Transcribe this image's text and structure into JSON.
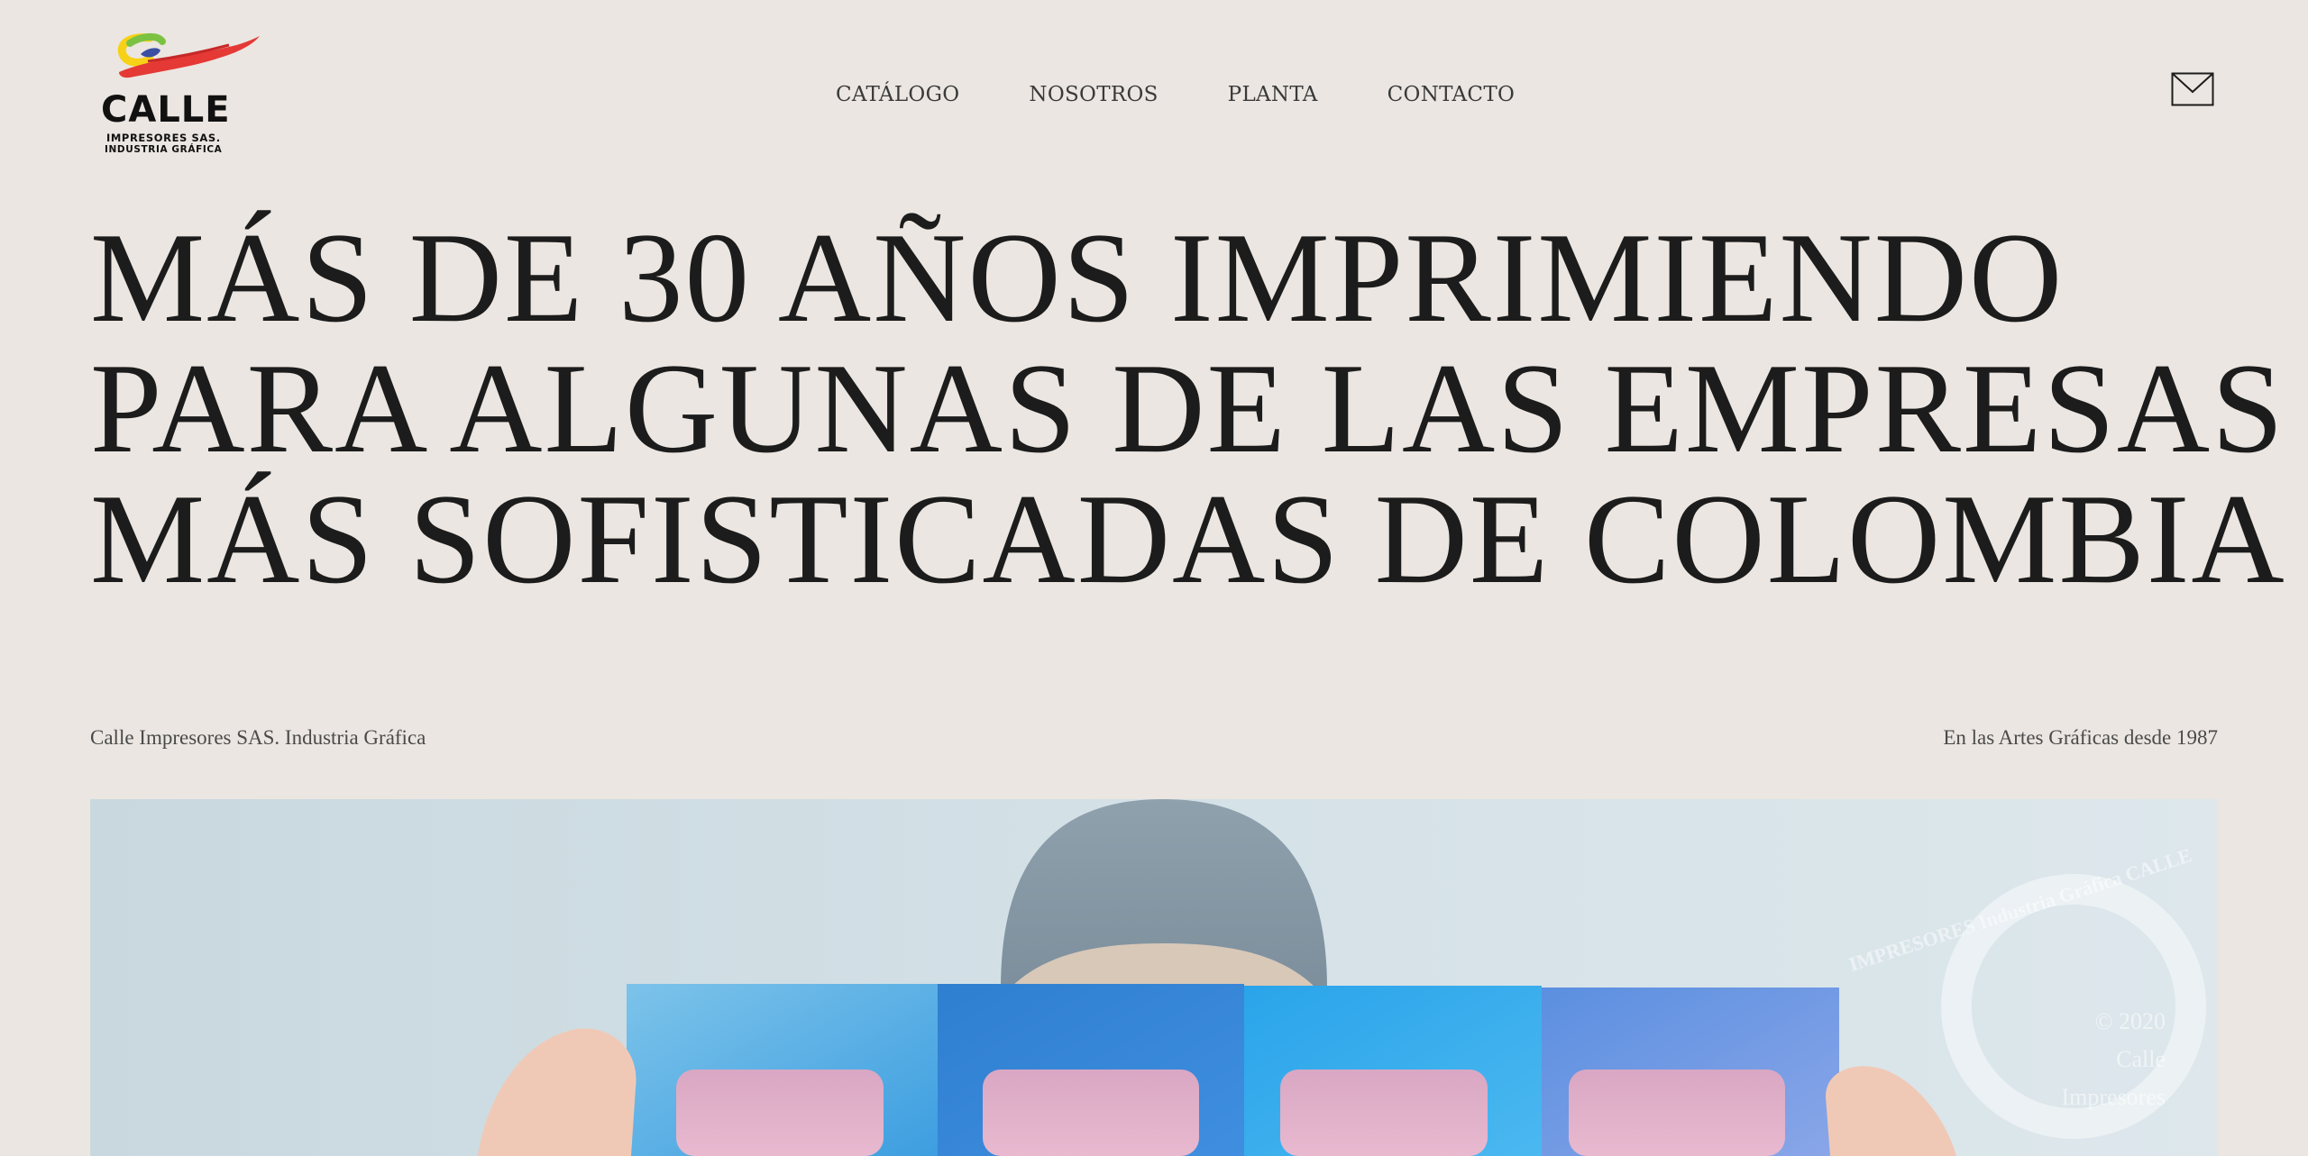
{
  "header": {
    "logo": {
      "word": "CALLE",
      "line1": "IMPRESORES SAS.",
      "line2": "INDUSTRIA GRÁFICA"
    },
    "nav": [
      {
        "label": "CATÁLOGO"
      },
      {
        "label": "NOSOTROS"
      },
      {
        "label": "PLANTA"
      },
      {
        "label": "CONTACTO"
      }
    ],
    "mail_icon": "mail-icon"
  },
  "hero": {
    "headline": [
      "MÁS DE 30 AÑOS IMPRIMIENDO",
      "PARA ALGUNAS DE LAS EMPRESAS",
      "MÁS SOFISTICADAS DE COLOMBIA"
    ],
    "subtitle_left": "Calle Impresores SAS. Industria Gráfica",
    "subtitle_right": "En las Artes Gráficas desde 1987"
  },
  "image_stamp": {
    "circle_text": "IMPRESORES Industria Gráfica CALLE",
    "line1": "© 2020",
    "line2": "Calle",
    "line3": "Impresores"
  },
  "colors": {
    "background": "#ebe6e1",
    "text": "#1c1c1c",
    "logo_red": "#e53935",
    "logo_green": "#7cc242",
    "logo_yellow": "#f7d117",
    "logo_blue": "#3b4fa3"
  }
}
